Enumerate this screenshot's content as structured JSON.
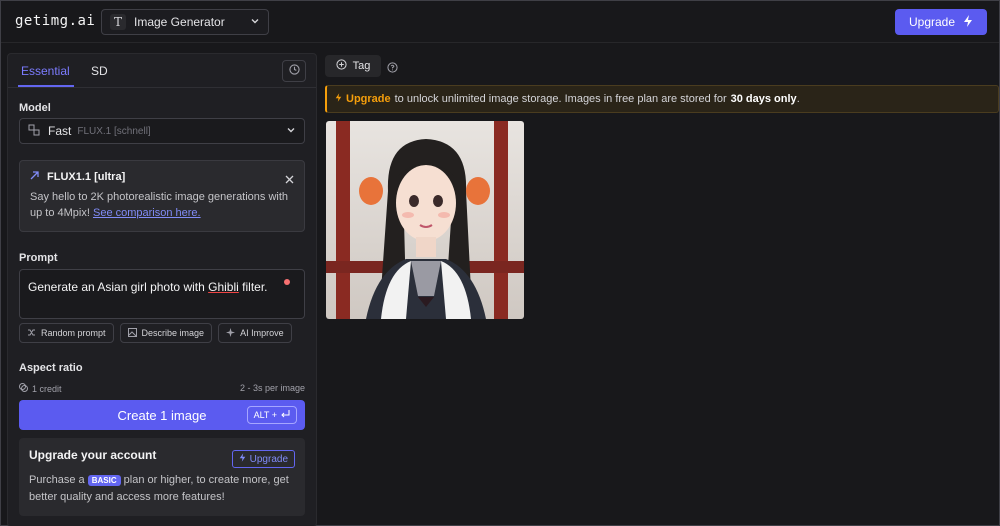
{
  "header": {
    "logo": "getimg.ai",
    "mode_select": {
      "icon": "text-T-icon",
      "label": "Image Generator"
    },
    "upgrade_button": {
      "label": "Upgrade",
      "icon": "lightning-icon"
    }
  },
  "left_panel": {
    "tabs": [
      {
        "label": "Essential",
        "active": true
      },
      {
        "label": "SD",
        "active": false
      }
    ],
    "model": {
      "label": "Model",
      "selected_name": "Fast",
      "selected_detail": "FLUX.1 [schnell]"
    },
    "promo": {
      "title": "FLUX1.1 [ultra]",
      "text": "Say hello to 2K photorealistic image generations with up to 4Mpix!",
      "link": "See comparison here."
    },
    "prompt": {
      "label": "Prompt",
      "text_before": "Generate an Asian girl photo with ",
      "text_underlined": "Ghibli",
      "text_after": " filter."
    },
    "tools": [
      "Random prompt",
      "Describe image",
      "AI Improve"
    ],
    "aspect_ratio_label": "Aspect ratio",
    "credit": "1 credit",
    "timing": "2 - 3s per image",
    "create_button": {
      "label": "Create 1 image",
      "shortcut": "ALT +"
    },
    "upgrade_card": {
      "title": "Upgrade your account",
      "button": "Upgrade",
      "text_before": "Purchase a",
      "badge": "BASIC",
      "text_after": "plan or higher, to create more, get better quality and access more features!"
    }
  },
  "main": {
    "tag_button": "Tag",
    "banner": {
      "highlight": "Upgrade",
      "text": "to unlock unlimited image storage. Images in free plan are stored for",
      "bold": "30 days only",
      "end": "."
    }
  },
  "colors": {
    "accent": "#5b5bf0",
    "warning": "#f59e0b",
    "background": "#18181b"
  }
}
